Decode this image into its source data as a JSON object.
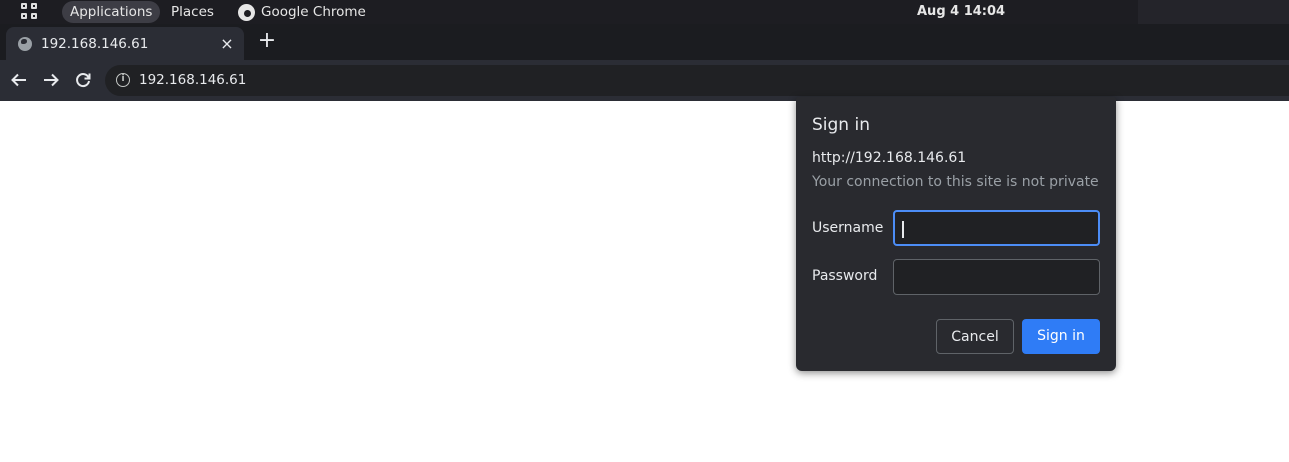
{
  "topbar": {
    "activities_icon": "apps-grid-icon",
    "applications": "Applications",
    "places": "Places",
    "app_indicator": "Google Chrome",
    "app_icon": "chrome-logo-icon",
    "clock": "Aug 4  14:04"
  },
  "browser": {
    "tab": {
      "title": "192.168.146.61",
      "favicon": "globe-icon",
      "close": "×"
    },
    "new_tab": "+",
    "toolbar": {
      "back_icon": "arrow-left-icon",
      "forward_icon": "arrow-right-icon",
      "reload_icon": "reload-icon",
      "site_info_icon": "info-icon",
      "url": "192.168.146.61"
    }
  },
  "dialog": {
    "title": "Sign in",
    "origin": "http://192.168.146.61",
    "warning": "Your connection to this site is not private",
    "username_label": "Username",
    "username_value": "",
    "password_label": "Password",
    "password_value": "",
    "cancel": "Cancel",
    "submit": "Sign in"
  },
  "colors": {
    "accent": "#2f7cf6",
    "focus_ring": "#4c8df6",
    "dialog_bg": "#292a2f",
    "toolbar_bg": "#2b2d35"
  }
}
